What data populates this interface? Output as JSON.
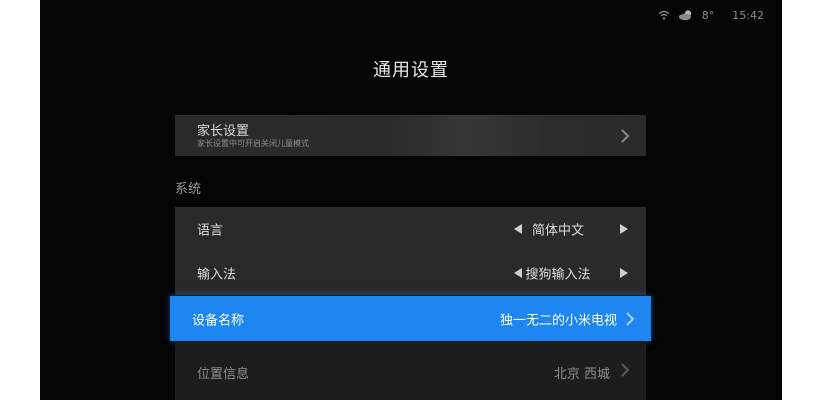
{
  "status_bar": {
    "temperature": "8°",
    "time": "15:42",
    "wifi_icon": "wifi-icon",
    "weather_icon": "cloudy-icon"
  },
  "page": {
    "title": "通用设置"
  },
  "parental": {
    "title": "家长设置",
    "subtitle": "家长设置中可开启关闭儿童模式"
  },
  "system": {
    "section_label": "系统",
    "rows": [
      {
        "label": "语言",
        "value": "简体中文",
        "control": "arrows"
      },
      {
        "label": "输入法",
        "value": "搜狗输入法",
        "control": "arrows"
      },
      {
        "label": "设备名称",
        "value": "独一无二的小米电视",
        "control": "chevron",
        "selected": true
      },
      {
        "label": "位置信息",
        "value": "北京 西城",
        "control": "chevron"
      }
    ]
  },
  "colors": {
    "background": "#050506",
    "panel": "#2a2a2d",
    "accent": "#1e86f0",
    "text": "#dedede"
  }
}
